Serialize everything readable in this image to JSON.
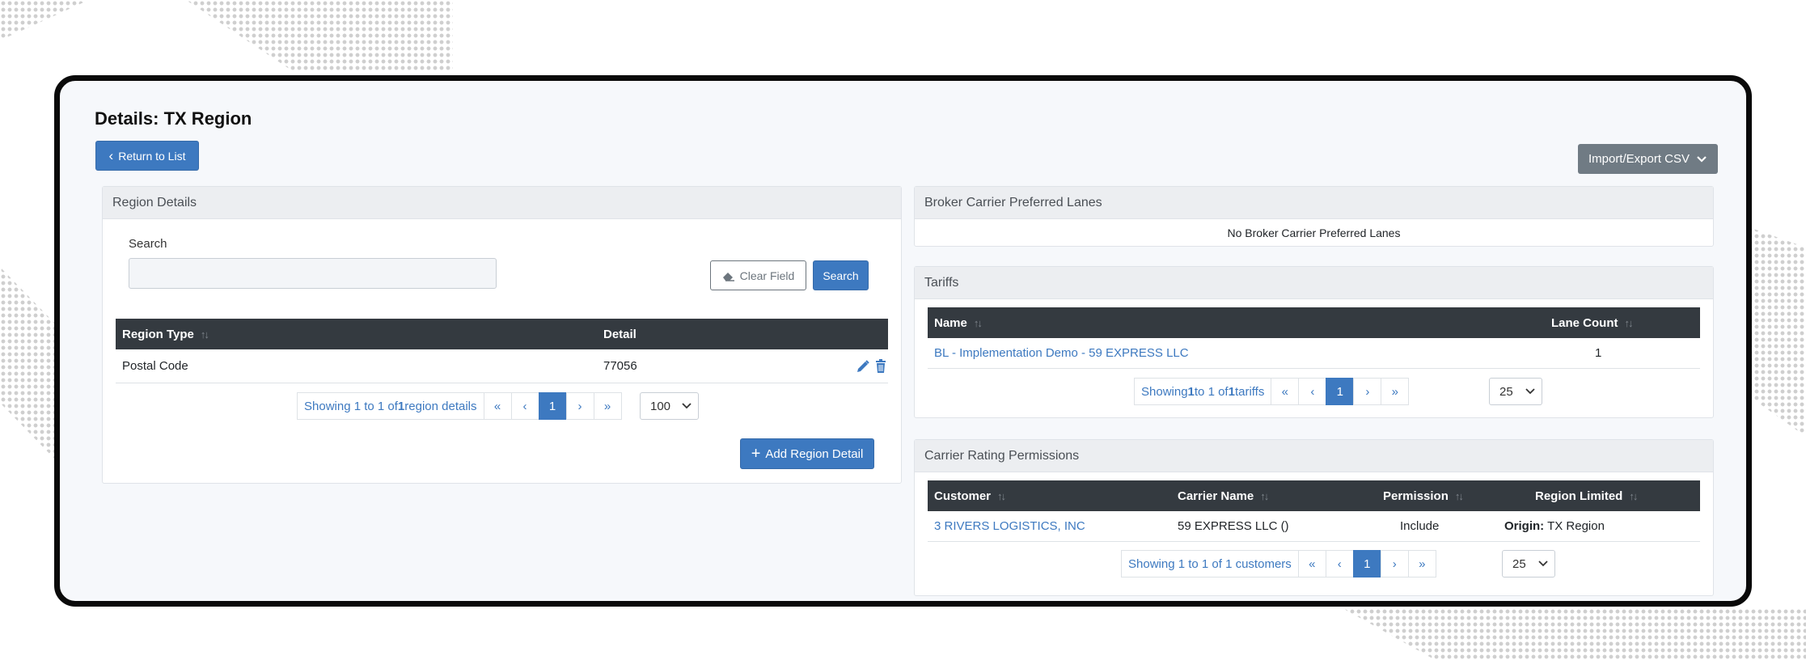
{
  "page": {
    "title": "Details: TX Region",
    "return_label": "Return to List",
    "import_export_label": "Import/Export CSV"
  },
  "region_details": {
    "heading": "Region Details",
    "search_label": "Search",
    "search_value": "",
    "clear_label": "Clear Field",
    "search_button": "Search",
    "columns": [
      "Region Type",
      "Detail"
    ],
    "rows": [
      {
        "type": "Postal Code",
        "detail": "77056"
      }
    ],
    "pager": {
      "info_prefix": "Showing 1 to 1 of ",
      "info_total": "1",
      "info_suffix": " region details",
      "first": "«",
      "prev": "‹",
      "page": "1",
      "next": "›",
      "last": "»",
      "per_page": "100"
    },
    "add_label": "Add Region Detail"
  },
  "preferred_lanes": {
    "heading": "Broker Carrier Preferred Lanes",
    "empty": "No Broker Carrier Preferred Lanes"
  },
  "tariffs": {
    "heading": "Tariffs",
    "columns": [
      "Name",
      "Lane Count"
    ],
    "rows": [
      {
        "name": "BL - Implementation Demo - 59 EXPRESS LLC",
        "lanes": "1"
      }
    ],
    "pager": {
      "info_prefix": "Showing ",
      "info_from": "1",
      "info_mid": " to 1 of ",
      "info_total": "1",
      "info_suffix": " tariffs",
      "first": "«",
      "prev": "‹",
      "page": "1",
      "next": "›",
      "last": "»",
      "per_page": "25"
    }
  },
  "permissions": {
    "heading": "Carrier Rating Permissions",
    "columns": [
      "Customer",
      "Carrier Name",
      "Permission",
      "Region Limited"
    ],
    "rows": [
      {
        "customer": "3 RIVERS LOGISTICS, INC",
        "carrier": "59 EXPRESS LLC ()",
        "permission": "Include",
        "region_key": "Origin:",
        "region_val": " TX Region"
      }
    ],
    "pager": {
      "info": "Showing 1 to 1 of 1 customers",
      "first": "«",
      "prev": "‹",
      "page": "1",
      "next": "›",
      "last": "»",
      "per_page": "25"
    }
  },
  "colors": {
    "primary": "#3d79c0",
    "table_header": "#343a40",
    "secondary": "#707b84"
  }
}
